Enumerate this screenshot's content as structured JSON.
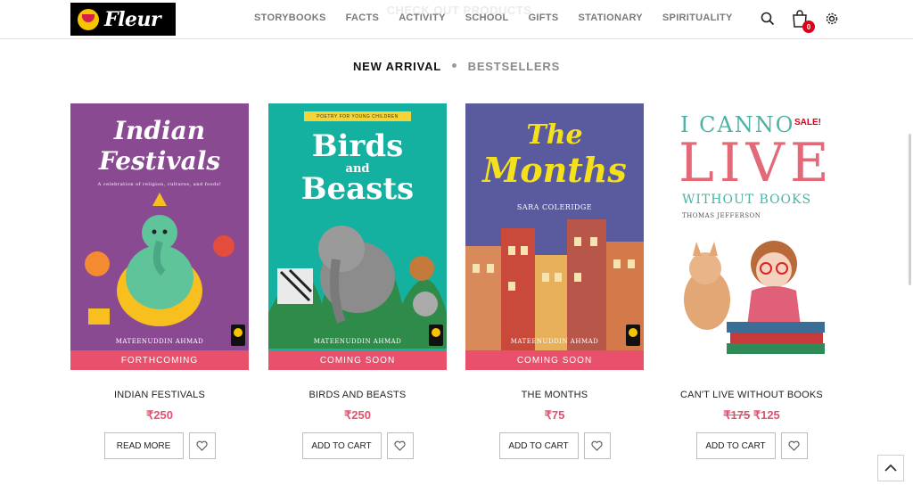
{
  "brand": {
    "logo_text": "Fleur"
  },
  "header": {
    "banner": "CHECK OUT PRODUCTS",
    "nav": [
      "STORYBOOKS",
      "FACTS",
      "ACTIVITY",
      "SCHOOL",
      "GIFTS",
      "STATIONARY",
      "SPIRITUALITY"
    ],
    "cart_count": "0",
    "icons": [
      "search-icon",
      "cart-icon",
      "settings-icon"
    ]
  },
  "tabs": {
    "active": "NEW ARRIVAL",
    "inactive": "BESTSELLERS"
  },
  "products": [
    {
      "name": "INDIAN FESTIVALS",
      "price": "₹250",
      "action": "READ MORE",
      "cover": {
        "title1": "Indian",
        "title2": "Festivals",
        "subtitle": "A celebration of religion, cultures, and foods!",
        "author": "MATEENUDDIN AHMAD",
        "band": "FORTHCOMING",
        "bg": "#8a4a92"
      }
    },
    {
      "name": "BIRDS AND BEASTS",
      "price": "₹250",
      "action": "ADD TO CART",
      "cover": {
        "tag": "POETRY FOR YOUNG CHILDREN",
        "title1": "Birds",
        "title_and": "and",
        "title2": "Beasts",
        "author": "MATEENUDDIN AHMAD",
        "band": "COMING SOON",
        "bg": "#14b0a0"
      }
    },
    {
      "name": "THE MONTHS",
      "price": "₹75",
      "action": "ADD TO CART",
      "cover": {
        "title1": "The",
        "title2": "Months",
        "poet": "SARA COLERIDGE",
        "author": "MATEENUDDIN AHMAD",
        "band": "COMING SOON",
        "bg": "#5a5b9e"
      }
    },
    {
      "name": "CAN'T LIVE WITHOUT BOOKS",
      "price_old": "₹175",
      "price": "₹125",
      "action": "ADD TO CART",
      "cover": {
        "sale": "SALE!",
        "title1": "I CANNO",
        "title2": "LIVE",
        "title3": "WITHOUT BOOKS",
        "author": "THOMAS JEFFERSON",
        "bg": "#ffffff"
      }
    }
  ]
}
